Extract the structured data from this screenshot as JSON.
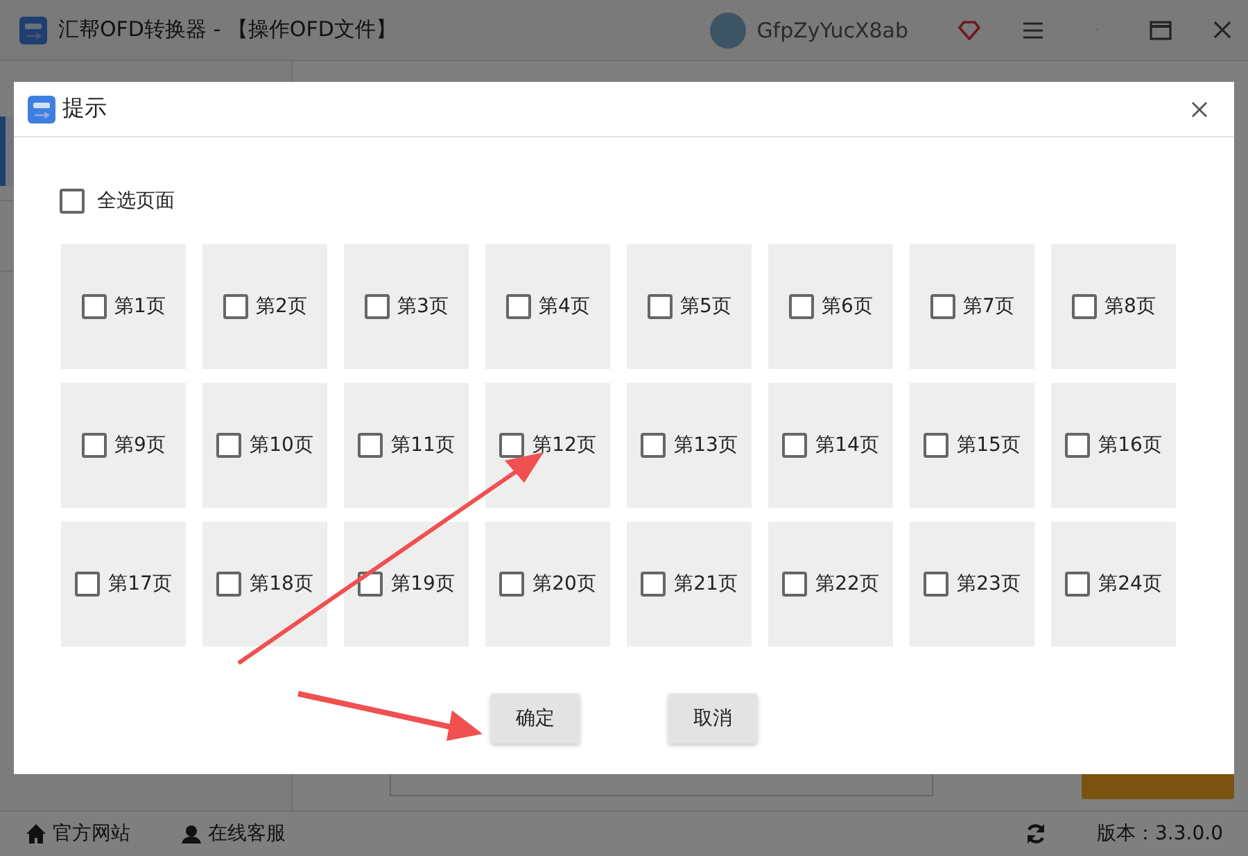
{
  "window": {
    "title": "汇帮OFD转换器 - 【操作OFD文件】",
    "user": "GfpZyYucX8ab"
  },
  "footer": {
    "links": [
      {
        "kind": "home",
        "label": "官方网站"
      },
      {
        "kind": "service",
        "label": "在线客服"
      }
    ],
    "version": "版本：3.3.0.0"
  },
  "dialog": {
    "title": "提示",
    "select_all": {
      "label": "全选页面",
      "checked": false
    },
    "pages": [
      {
        "label": "第1页",
        "checked": false
      },
      {
        "label": "第2页",
        "checked": false
      },
      {
        "label": "第3页",
        "checked": false
      },
      {
        "label": "第4页",
        "checked": false
      },
      {
        "label": "第5页",
        "checked": false
      },
      {
        "label": "第6页",
        "checked": false
      },
      {
        "label": "第7页",
        "checked": false
      },
      {
        "label": "第8页",
        "checked": false
      },
      {
        "label": "第9页",
        "checked": false
      },
      {
        "label": "第10页",
        "checked": false
      },
      {
        "label": "第11页",
        "checked": false
      },
      {
        "label": "第12页",
        "checked": false
      },
      {
        "label": "第13页",
        "checked": false
      },
      {
        "label": "第14页",
        "checked": false
      },
      {
        "label": "第15页",
        "checked": false
      },
      {
        "label": "第16页",
        "checked": false
      },
      {
        "label": "第17页",
        "checked": false
      },
      {
        "label": "第18页",
        "checked": false
      },
      {
        "label": "第19页",
        "checked": false
      },
      {
        "label": "第20页",
        "checked": false
      },
      {
        "label": "第21页",
        "checked": false
      },
      {
        "label": "第22页",
        "checked": false
      },
      {
        "label": "第23页",
        "checked": false
      },
      {
        "label": "第24页",
        "checked": false
      }
    ],
    "buttons": [
      "确定",
      "取消"
    ]
  }
}
